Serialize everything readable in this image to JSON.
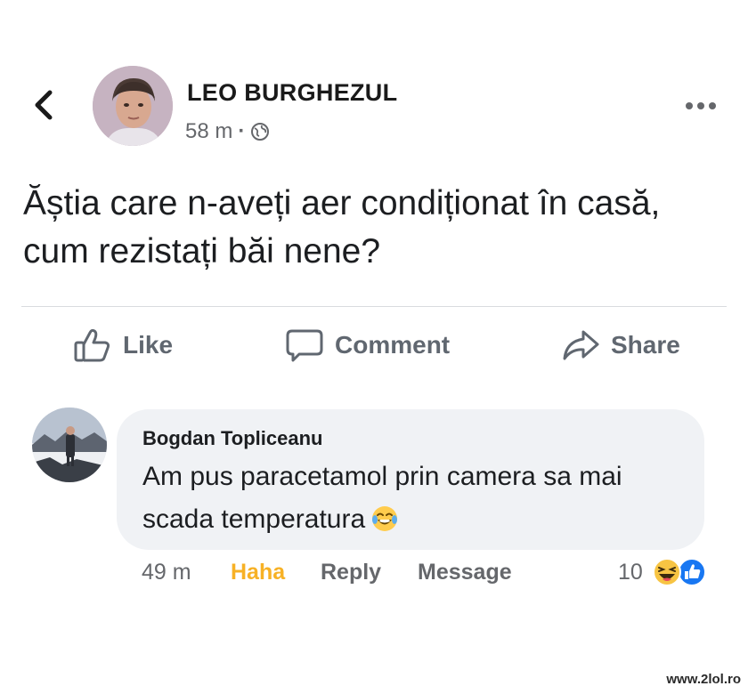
{
  "post": {
    "author": "LEO BURGHEZUL",
    "time": "58 m",
    "separator": "·",
    "visibility_icon": "globe-icon",
    "text": "Ăștia care n-aveți aer condiționat în casă, cum rezistați băi nene?"
  },
  "actions": {
    "like_label": "Like",
    "comment_label": "Comment",
    "share_label": "Share"
  },
  "comment": {
    "author": "Bogdan Topliceanu",
    "text": "Am pus paracetamol prin camera sa mai scada temperatura",
    "emoji": "laughing-tears-emoji",
    "time": "49 m",
    "reaction_label": "Haha",
    "reply_label": "Reply",
    "message_label": "Message",
    "reaction_count": "10",
    "reaction_icons": [
      "haha-reaction-icon",
      "like-reaction-icon"
    ]
  },
  "colors": {
    "haha": "#f7b125",
    "like_blue": "#1877f2",
    "muted": "#65676b",
    "bubble": "#f0f2f5"
  },
  "watermark": "www.2lol.ro"
}
